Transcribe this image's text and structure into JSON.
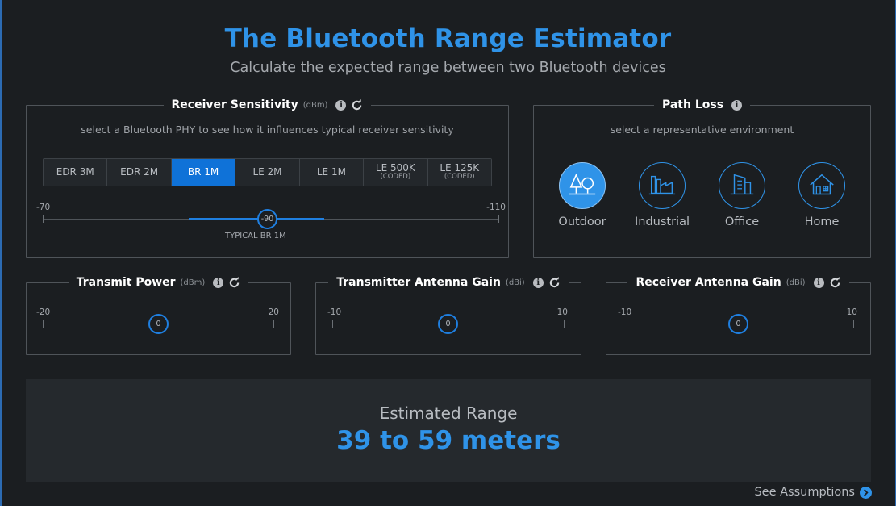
{
  "header": {
    "title": "The Bluetooth Range Estimator",
    "subtitle": "Calculate the expected range between two Bluetooth devices"
  },
  "receiver_sensitivity": {
    "title": "Receiver Sensitivity",
    "unit": "(dBm)",
    "hint": "select a Bluetooth PHY to see how it influences typical receiver sensitivity",
    "phy_options": [
      {
        "label": "EDR 3M",
        "sub": ""
      },
      {
        "label": "EDR 2M",
        "sub": ""
      },
      {
        "label": "BR 1M",
        "sub": ""
      },
      {
        "label": "LE 2M",
        "sub": ""
      },
      {
        "label": "LE 1M",
        "sub": ""
      },
      {
        "label": "LE 500K",
        "sub": "(CODED)"
      },
      {
        "label": "LE 125K",
        "sub": "(CODED)"
      }
    ],
    "selected_phy": "BR 1M",
    "slider": {
      "min": "-70",
      "max": "-110",
      "value": "-90",
      "caption": "TYPICAL BR 1M"
    }
  },
  "path_loss": {
    "title": "Path Loss",
    "hint": "select a representative environment",
    "environments": [
      {
        "label": "Outdoor",
        "icon": "trees-icon"
      },
      {
        "label": "Industrial",
        "icon": "factory-icon"
      },
      {
        "label": "Office",
        "icon": "office-building-icon"
      },
      {
        "label": "Home",
        "icon": "house-icon"
      }
    ],
    "selected": "Outdoor"
  },
  "transmit_power": {
    "title": "Transmit Power",
    "unit": "(dBm)",
    "slider": {
      "min": "-20",
      "max": "20",
      "value": "0"
    }
  },
  "tx_antenna_gain": {
    "title": "Transmitter Antenna Gain",
    "unit": "(dBi)",
    "slider": {
      "min": "-10",
      "max": "10",
      "value": "0"
    }
  },
  "rx_antenna_gain": {
    "title": "Receiver Antenna Gain",
    "unit": "(dBi)",
    "slider": {
      "min": "-10",
      "max": "10",
      "value": "0"
    }
  },
  "result": {
    "label": "Estimated Range",
    "value": "39 to 59 meters"
  },
  "footer": {
    "assumptions_link": "See Assumptions"
  },
  "colors": {
    "accent": "#2f93e8",
    "background": "#1b1e21",
    "panel_border": "#4f5459",
    "result_background": "#25292d"
  }
}
